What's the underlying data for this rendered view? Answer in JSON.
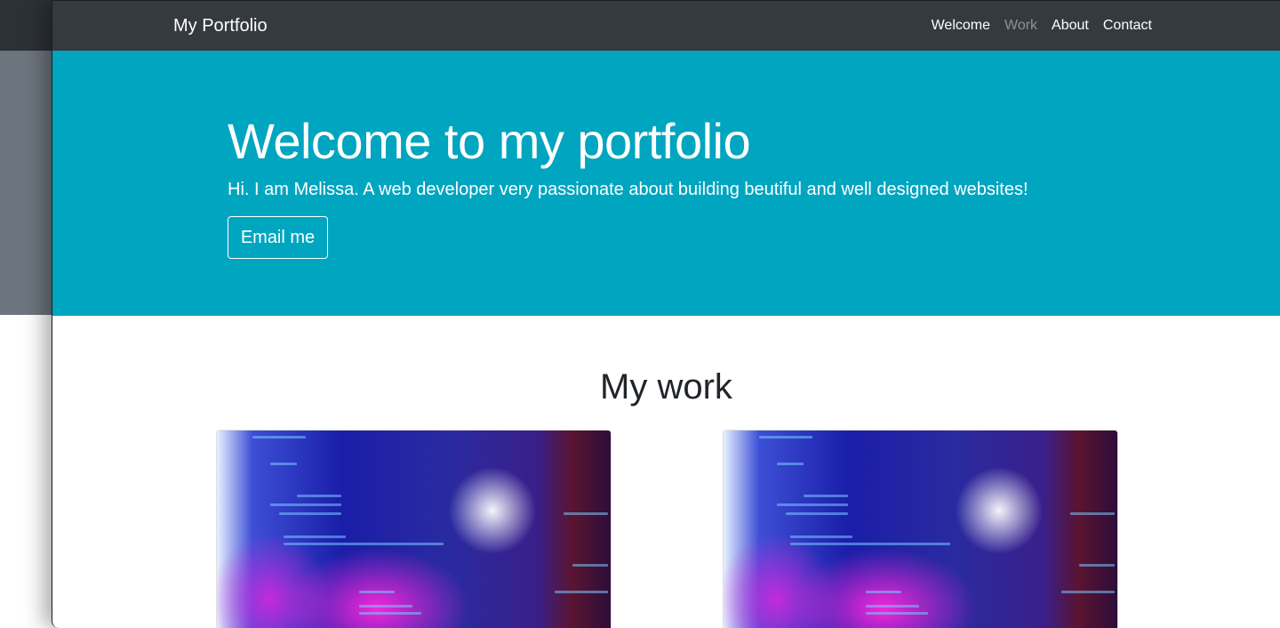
{
  "navbar": {
    "brand": "My Portfolio",
    "links": [
      {
        "label": "Welcome"
      },
      {
        "label": "Work",
        "muted": true
      },
      {
        "label": "About"
      },
      {
        "label": "Contact"
      }
    ]
  },
  "hero": {
    "title": "Welcome to my portfolio",
    "subtitle": "Hi. I am Melissa. A web developer very passionate about building beutiful and well designed websites!",
    "button_label": "Email me"
  },
  "work": {
    "title": "My work",
    "cards": [
      {
        "image": "code-on-screen-photo"
      },
      {
        "image": "code-on-screen-photo"
      }
    ]
  },
  "colors": {
    "navbar_bg": "#343a40",
    "hero_bg": "#00a5c0",
    "text_dark": "#212529",
    "nav_muted": "#8e9296"
  }
}
